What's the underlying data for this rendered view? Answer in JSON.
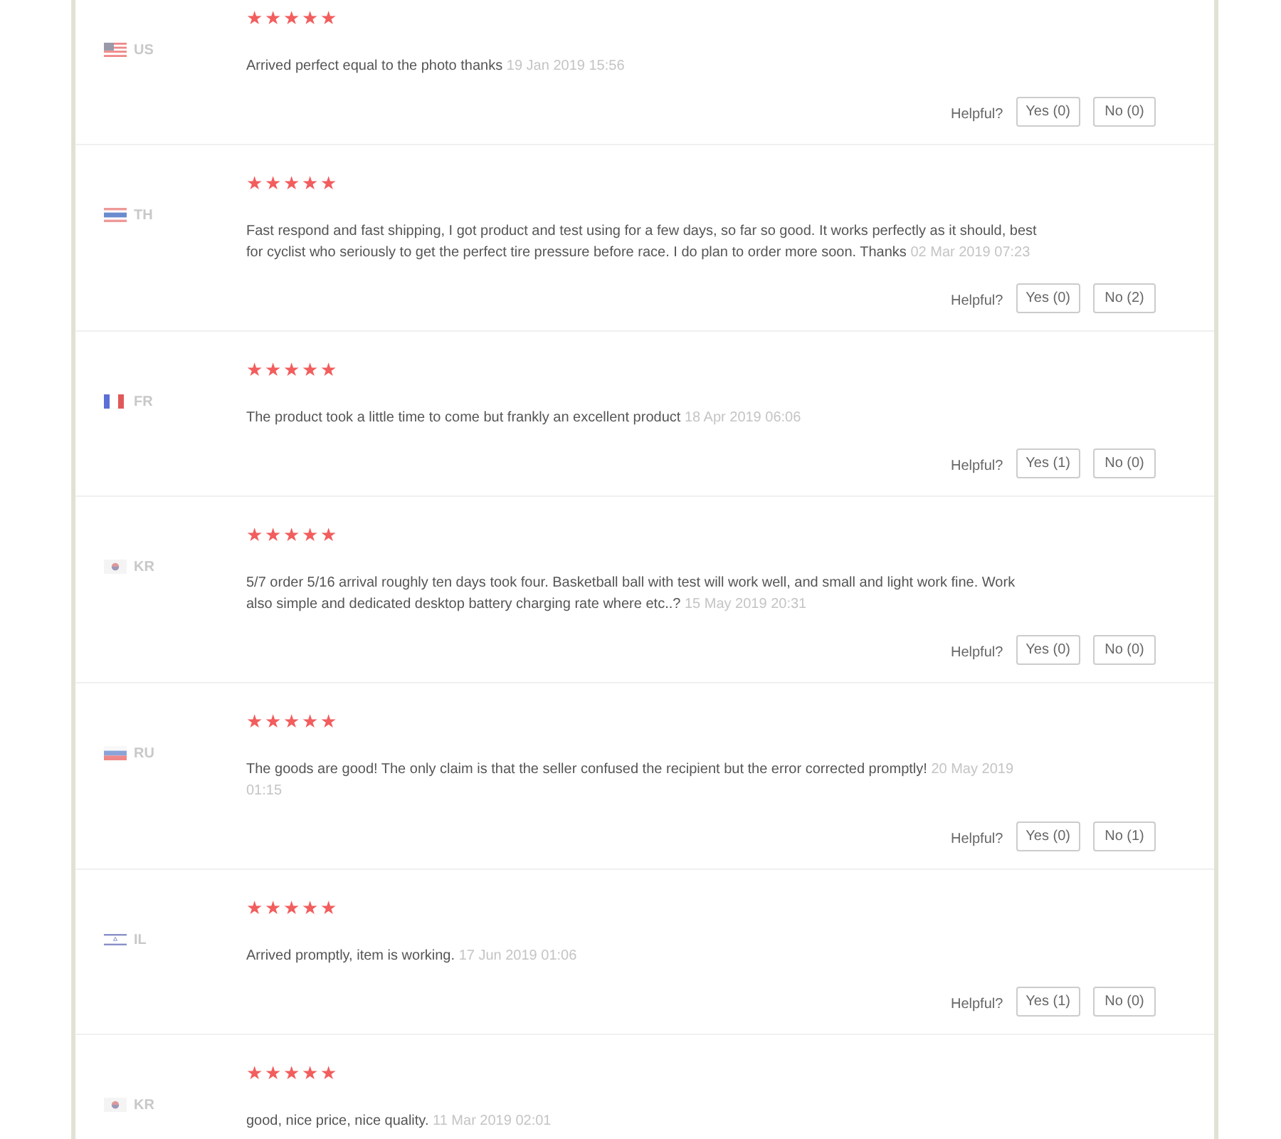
{
  "reviews": [
    {
      "kind": "us",
      "country": "US",
      "stars": 5,
      "text": "Arrived perfect equal to the photo thanks",
      "date": "19 Jan 2019 15:56",
      "helpful": {
        "label": "Helpful?",
        "yes": "Yes (0)",
        "no": "No (0)"
      }
    },
    {
      "kind": "th",
      "country": "TH",
      "stars": 5,
      "text": "Fast respond and fast shipping, I got product and test using for a few days, so far so good. It works perfectly as it should, best for cyclist who seriously to get the perfect tire pressure before race. I do plan to order more soon. Thanks",
      "date": "02 Mar 2019 07:23",
      "helpful": {
        "label": "Helpful?",
        "yes": "Yes (0)",
        "no": "No (2)"
      }
    },
    {
      "kind": "fr",
      "country": "FR",
      "stars": 5,
      "text": "The product took a little time to come but frankly an excellent product",
      "date": "18 Apr 2019 06:06",
      "helpful": {
        "label": "Helpful?",
        "yes": "Yes (1)",
        "no": "No (0)"
      }
    },
    {
      "kind": "kr",
      "country": "KR",
      "stars": 5,
      "text": "5/7 order 5/16 arrival roughly ten days took four. Basketball ball with test will work well, and small and light work fine. Work also simple and dedicated desktop battery charging rate where etc..?",
      "date": "15 May 2019 20:31",
      "helpful": {
        "label": "Helpful?",
        "yes": "Yes (0)",
        "no": "No (0)"
      }
    },
    {
      "kind": "ru",
      "country": "RU",
      "stars": 5,
      "text": "The goods are good! The only claim is that the seller confused the recipient but the error corrected promptly!",
      "date": "20 May 2019 01:15",
      "helpful": {
        "label": "Helpful?",
        "yes": "Yes (0)",
        "no": "No (1)"
      }
    },
    {
      "kind": "il",
      "country": "IL",
      "stars": 5,
      "text": "Arrived promptly, item is working.",
      "date": "17 Jun 2019 01:06",
      "helpful": {
        "label": "Helpful?",
        "yes": "Yes (1)",
        "no": "No (0)"
      }
    },
    {
      "kind": "kr",
      "country": "KR",
      "stars": 5,
      "text": "good, nice price, nice quality.",
      "date": "11 Mar 2019 02:01"
    }
  ]
}
